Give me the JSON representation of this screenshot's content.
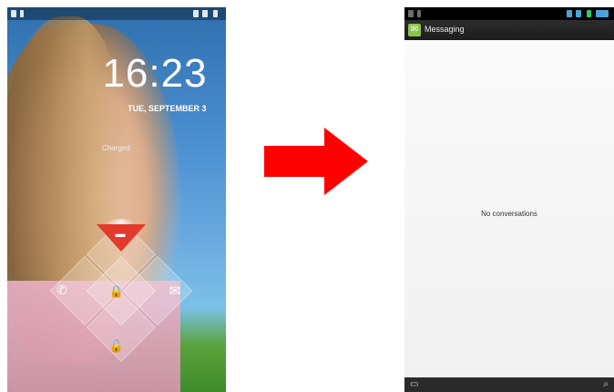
{
  "lock_screen": {
    "time": "16:23",
    "date": "TUE, SEPTEMBER 3",
    "status": "Charged",
    "targets": [
      "phone-icon",
      "lock-icon",
      "envelope-icon",
      "unlock-icon",
      "camera-icon"
    ]
  },
  "transition": {
    "arrow_color": "#ff0000"
  },
  "messaging_app": {
    "title": "Messaging",
    "empty_text": "No conversations",
    "bottom_actions": [
      "compose-icon",
      "search-icon"
    ]
  }
}
